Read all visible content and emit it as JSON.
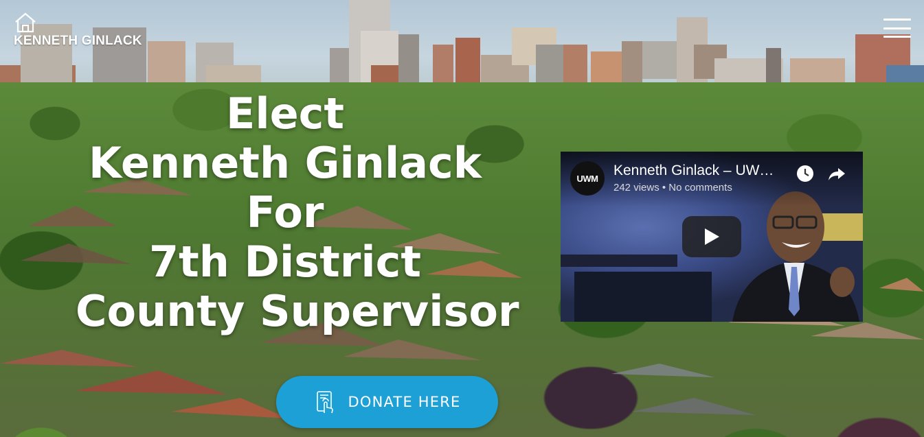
{
  "header": {
    "logo_text": "KENNETH GINLACK",
    "logo_icon": "house-outline-icon",
    "menu_icon": "hamburger-menu-icon"
  },
  "hero": {
    "lines": [
      "Elect",
      "Kenneth Ginlack",
      "For",
      "7th District",
      "County Supervisor"
    ]
  },
  "video": {
    "channel_logo": "UWM",
    "title": "Kenneth Ginlack – UW…",
    "meta": "242 views • No comments",
    "watch_later_icon": "clock-icon",
    "share_icon": "share-arrow-icon",
    "play_icon": "play-icon"
  },
  "donate": {
    "label": "DONATE HERE",
    "icon": "tap-device-icon",
    "color": "#1da0d6"
  }
}
